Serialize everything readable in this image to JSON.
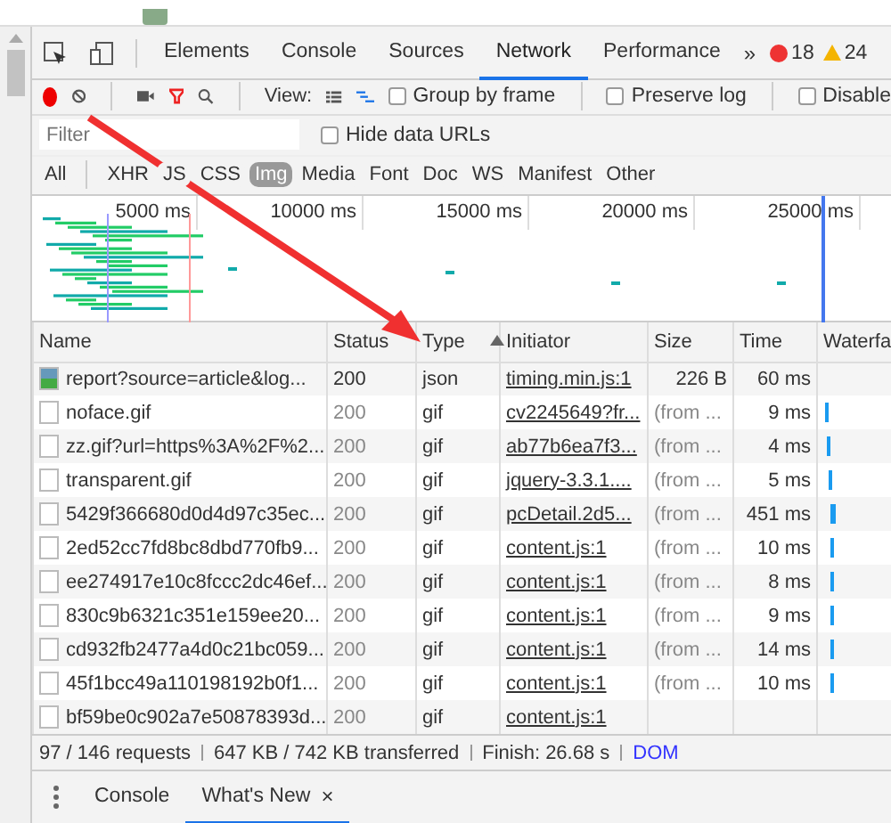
{
  "panel_tabs": [
    {
      "label": "Elements",
      "selected": false
    },
    {
      "label": "Console",
      "selected": false
    },
    {
      "label": "Sources",
      "selected": false
    },
    {
      "label": "Network",
      "selected": true
    },
    {
      "label": "Performance",
      "selected": false
    }
  ],
  "more": "»",
  "errors": "18",
  "warnings": "24",
  "toolbar": {
    "recording": true,
    "view_label": "View:",
    "options": [
      {
        "label": "Group by frame",
        "checked": false
      },
      {
        "label": "Preserve log",
        "checked": false
      },
      {
        "label": "Disable",
        "checked": false
      }
    ]
  },
  "filter": {
    "placeholder": "Filter",
    "hide_data_urls": {
      "label": "Hide data URLs",
      "checked": false
    }
  },
  "type_filters": [
    {
      "label": "All",
      "selected": false
    },
    {
      "label": "XHR",
      "selected": false
    },
    {
      "label": "JS",
      "selected": false
    },
    {
      "label": "CSS",
      "selected": false
    },
    {
      "label": "Img",
      "selected": true
    },
    {
      "label": "Media",
      "selected": false
    },
    {
      "label": "Font",
      "selected": false
    },
    {
      "label": "Doc",
      "selected": false
    },
    {
      "label": "WS",
      "selected": false
    },
    {
      "label": "Manifest",
      "selected": false
    },
    {
      "label": "Other",
      "selected": false
    }
  ],
  "overview_ticks": [
    "5000 ms",
    "10000 ms",
    "15000 ms",
    "20000 ms",
    "25000 ms"
  ],
  "table": {
    "columns": [
      "Name",
      "Status",
      "Type",
      "Initiator",
      "Size",
      "Time",
      "Waterfa"
    ],
    "rows": [
      {
        "name": "report?source=article&log...",
        "status": "200",
        "type": "json",
        "initiator": "timing.min.js:1",
        "size": "226 B",
        "time": "60 ms"
      },
      {
        "name": "noface.gif",
        "status": "200",
        "type": "gif",
        "initiator": "cv2245649?fr...",
        "size": "(from ...",
        "time": "9 ms"
      },
      {
        "name": "zz.gif?url=https%3A%2F%2...",
        "status": "200",
        "type": "gif",
        "initiator": "ab77b6ea7f3...",
        "size": "(from ...",
        "time": "4 ms"
      },
      {
        "name": "transparent.gif",
        "status": "200",
        "type": "gif",
        "initiator": "jquery-3.3.1....",
        "size": "(from ...",
        "time": "5 ms"
      },
      {
        "name": "5429f366680d0d4d97c35ec...",
        "status": "200",
        "type": "gif",
        "initiator": "pcDetail.2d5...",
        "size": "(from ...",
        "time": "451 ms"
      },
      {
        "name": "2ed52cc7fd8bc8dbd770fb9...",
        "status": "200",
        "type": "gif",
        "initiator": "content.js:1",
        "size": "(from ...",
        "time": "10 ms"
      },
      {
        "name": "ee274917e10c8fccc2dc46ef...",
        "status": "200",
        "type": "gif",
        "initiator": "content.js:1",
        "size": "(from ...",
        "time": "8 ms"
      },
      {
        "name": "830c9b6321c351e159ee20...",
        "status": "200",
        "type": "gif",
        "initiator": "content.js:1",
        "size": "(from ...",
        "time": "9 ms"
      },
      {
        "name": "cd932fb2477a4d0c21bc059...",
        "status": "200",
        "type": "gif",
        "initiator": "content.js:1",
        "size": "(from ...",
        "time": "14 ms"
      },
      {
        "name": "45f1bcc49a110198192b0f1...",
        "status": "200",
        "type": "gif",
        "initiator": "content.js:1",
        "size": "(from ...",
        "time": "10 ms"
      },
      {
        "name": "bf59be0c902a7e50878393d...",
        "status": "200",
        "type": "gif",
        "initiator": "content.js:1"
      }
    ]
  },
  "status_bar": [
    "97 / 146 requests",
    "647 KB / 742 KB transferred",
    "Finish: 26.68 s",
    "DOM"
  ],
  "drawer_tabs": [
    {
      "label": "Console",
      "selected": false
    },
    {
      "label": "What's New",
      "selected": true,
      "closable": true
    }
  ],
  "close": "×"
}
